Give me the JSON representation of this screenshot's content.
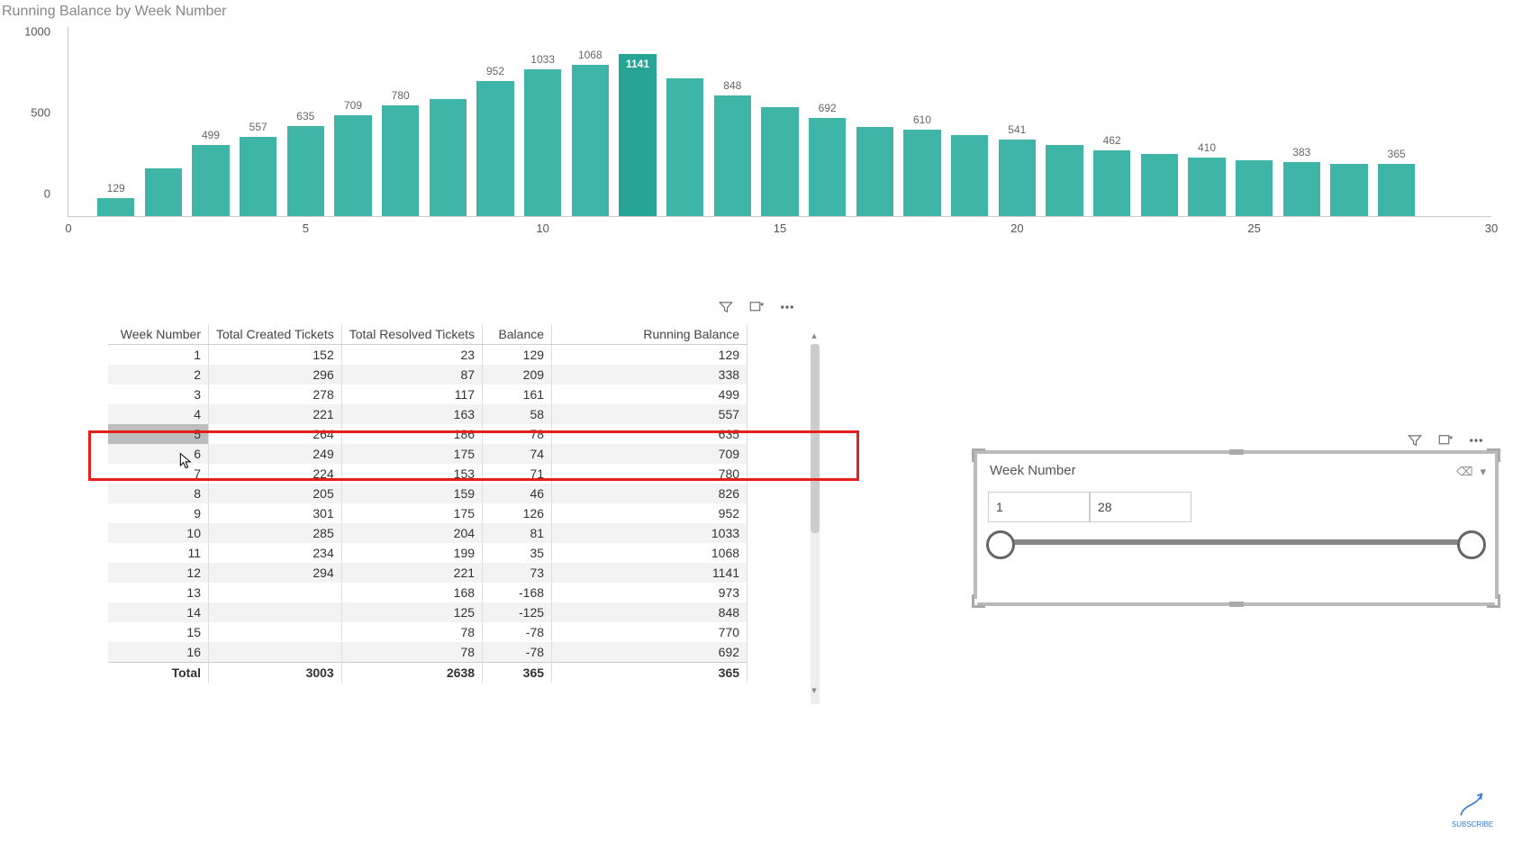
{
  "chart": {
    "title": "Running Balance by Week Number"
  },
  "chart_data": {
    "type": "bar",
    "title": "Running Balance by Week Number",
    "xlabel": "",
    "ylabel": "",
    "ylim": [
      0,
      1141
    ],
    "y_ticks": [
      0,
      500,
      1000
    ],
    "x_ticks": [
      0,
      5,
      10,
      15,
      20,
      25,
      30
    ],
    "categories": [
      1,
      2,
      3,
      4,
      5,
      6,
      7,
      8,
      9,
      10,
      11,
      12,
      13,
      14,
      15,
      16,
      17,
      18,
      19,
      20,
      21,
      22,
      23,
      24,
      25,
      26,
      27,
      28
    ],
    "values": [
      129,
      338,
      499,
      557,
      635,
      709,
      780,
      826,
      952,
      1033,
      1068,
      1141,
      973,
      848,
      770,
      692,
      630,
      610,
      570,
      541,
      500,
      462,
      440,
      410,
      395,
      383,
      370,
      365
    ],
    "value_labels": [
      129,
      null,
      499,
      557,
      635,
      709,
      780,
      null,
      952,
      1033,
      1068,
      1141,
      null,
      848,
      null,
      692,
      null,
      610,
      null,
      541,
      null,
      462,
      null,
      410,
      null,
      383,
      null,
      365
    ],
    "highlight_index": 11
  },
  "table": {
    "headers": [
      "Week Number",
      "Total Created Tickets",
      "Total Resolved Tickets",
      "Balance",
      "Running Balance"
    ],
    "rows": [
      {
        "wn": 1,
        "tc": 152,
        "tr": 23,
        "b": 129,
        "rb": 129
      },
      {
        "wn": 2,
        "tc": 296,
        "tr": 87,
        "b": 209,
        "rb": 338
      },
      {
        "wn": 3,
        "tc": 278,
        "tr": 117,
        "b": 161,
        "rb": 499
      },
      {
        "wn": 4,
        "tc": 221,
        "tr": 163,
        "b": 58,
        "rb": 557
      },
      {
        "wn": 5,
        "tc": 264,
        "tr": 186,
        "b": 78,
        "rb": 635
      },
      {
        "wn": 6,
        "tc": 249,
        "tr": 175,
        "b": 74,
        "rb": 709
      },
      {
        "wn": 7,
        "tc": 224,
        "tr": 153,
        "b": 71,
        "rb": 780
      },
      {
        "wn": 8,
        "tc": 205,
        "tr": 159,
        "b": 46,
        "rb": 826
      },
      {
        "wn": 9,
        "tc": 301,
        "tr": 175,
        "b": 126,
        "rb": 952
      },
      {
        "wn": 10,
        "tc": 285,
        "tr": 204,
        "b": 81,
        "rb": 1033
      },
      {
        "wn": 11,
        "tc": 234,
        "tr": 199,
        "b": 35,
        "rb": 1068
      },
      {
        "wn": 12,
        "tc": 294,
        "tr": 221,
        "b": 73,
        "rb": 1141
      },
      {
        "wn": 13,
        "tc": "",
        "tr": 168,
        "b": -168,
        "rb": 973
      },
      {
        "wn": 14,
        "tc": "",
        "tr": 125,
        "b": -125,
        "rb": 848
      },
      {
        "wn": 15,
        "tc": "",
        "tr": 78,
        "b": -78,
        "rb": 770
      },
      {
        "wn": 16,
        "tc": "",
        "tr": 78,
        "b": -78,
        "rb": 692
      }
    ],
    "total": {
      "label": "Total",
      "tc": 3003,
      "tr": 2638,
      "b": 365,
      "rb": 365
    }
  },
  "slicer": {
    "title": "Week Number",
    "min": 1,
    "max": 28
  },
  "subscribe": {
    "label": "SUBSCRIBE"
  }
}
